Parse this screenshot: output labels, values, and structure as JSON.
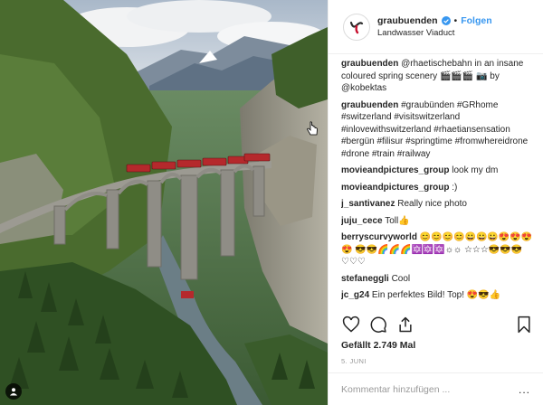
{
  "header": {
    "username": "graubuenden",
    "dot": "•",
    "follow_label": "Folgen",
    "location": "Landwasser Viaduct"
  },
  "comments": [
    {
      "user": "graubuenden",
      "text": "@rhaetischebahn in an insane coloured spring scenery 🎬🎬🎬 📷 by @kobektas"
    },
    {
      "user": "graubuenden",
      "text": "#graubünden #GRhome #switzerland #visitswitzerland #inlovewithswitzerland #rhaetiansensation #bergün #filisur #springtime #fromwhereidrone #drone #train #railway"
    },
    {
      "user": "movieandpictures_group",
      "text": "look my dm"
    },
    {
      "user": "movieandpictures_group",
      "text": ":)"
    },
    {
      "user": "j_santivanez",
      "text": "Really nice photo"
    },
    {
      "user": "juju_cece",
      "text": "Toll👍"
    },
    {
      "user": "berryscurvyworld",
      "text": "😊😊😊😊😀😀😀😍😍😍😍 😎😎🌈🌈🌈🔯🔯🔯☼☼ ☆☆☆😎😎😎♡♡♡"
    },
    {
      "user": "stefaneggli",
      "text": "Cool"
    },
    {
      "user": "jc_g24",
      "text": "Ein perfektes Bild! Top! 😍😎👍"
    }
  ],
  "likes": "Gefällt 2.749 Mal",
  "date": "5. JUNI",
  "comment_input": {
    "placeholder": "Kommentar hinzufügen ..."
  },
  "more": "...",
  "icons": {
    "like": "heart-icon",
    "comment": "comment-icon",
    "share": "share-icon",
    "save": "bookmark-icon"
  },
  "colors": {
    "link": "#3897f0",
    "hashtag": "#003569",
    "muted": "#999999"
  }
}
